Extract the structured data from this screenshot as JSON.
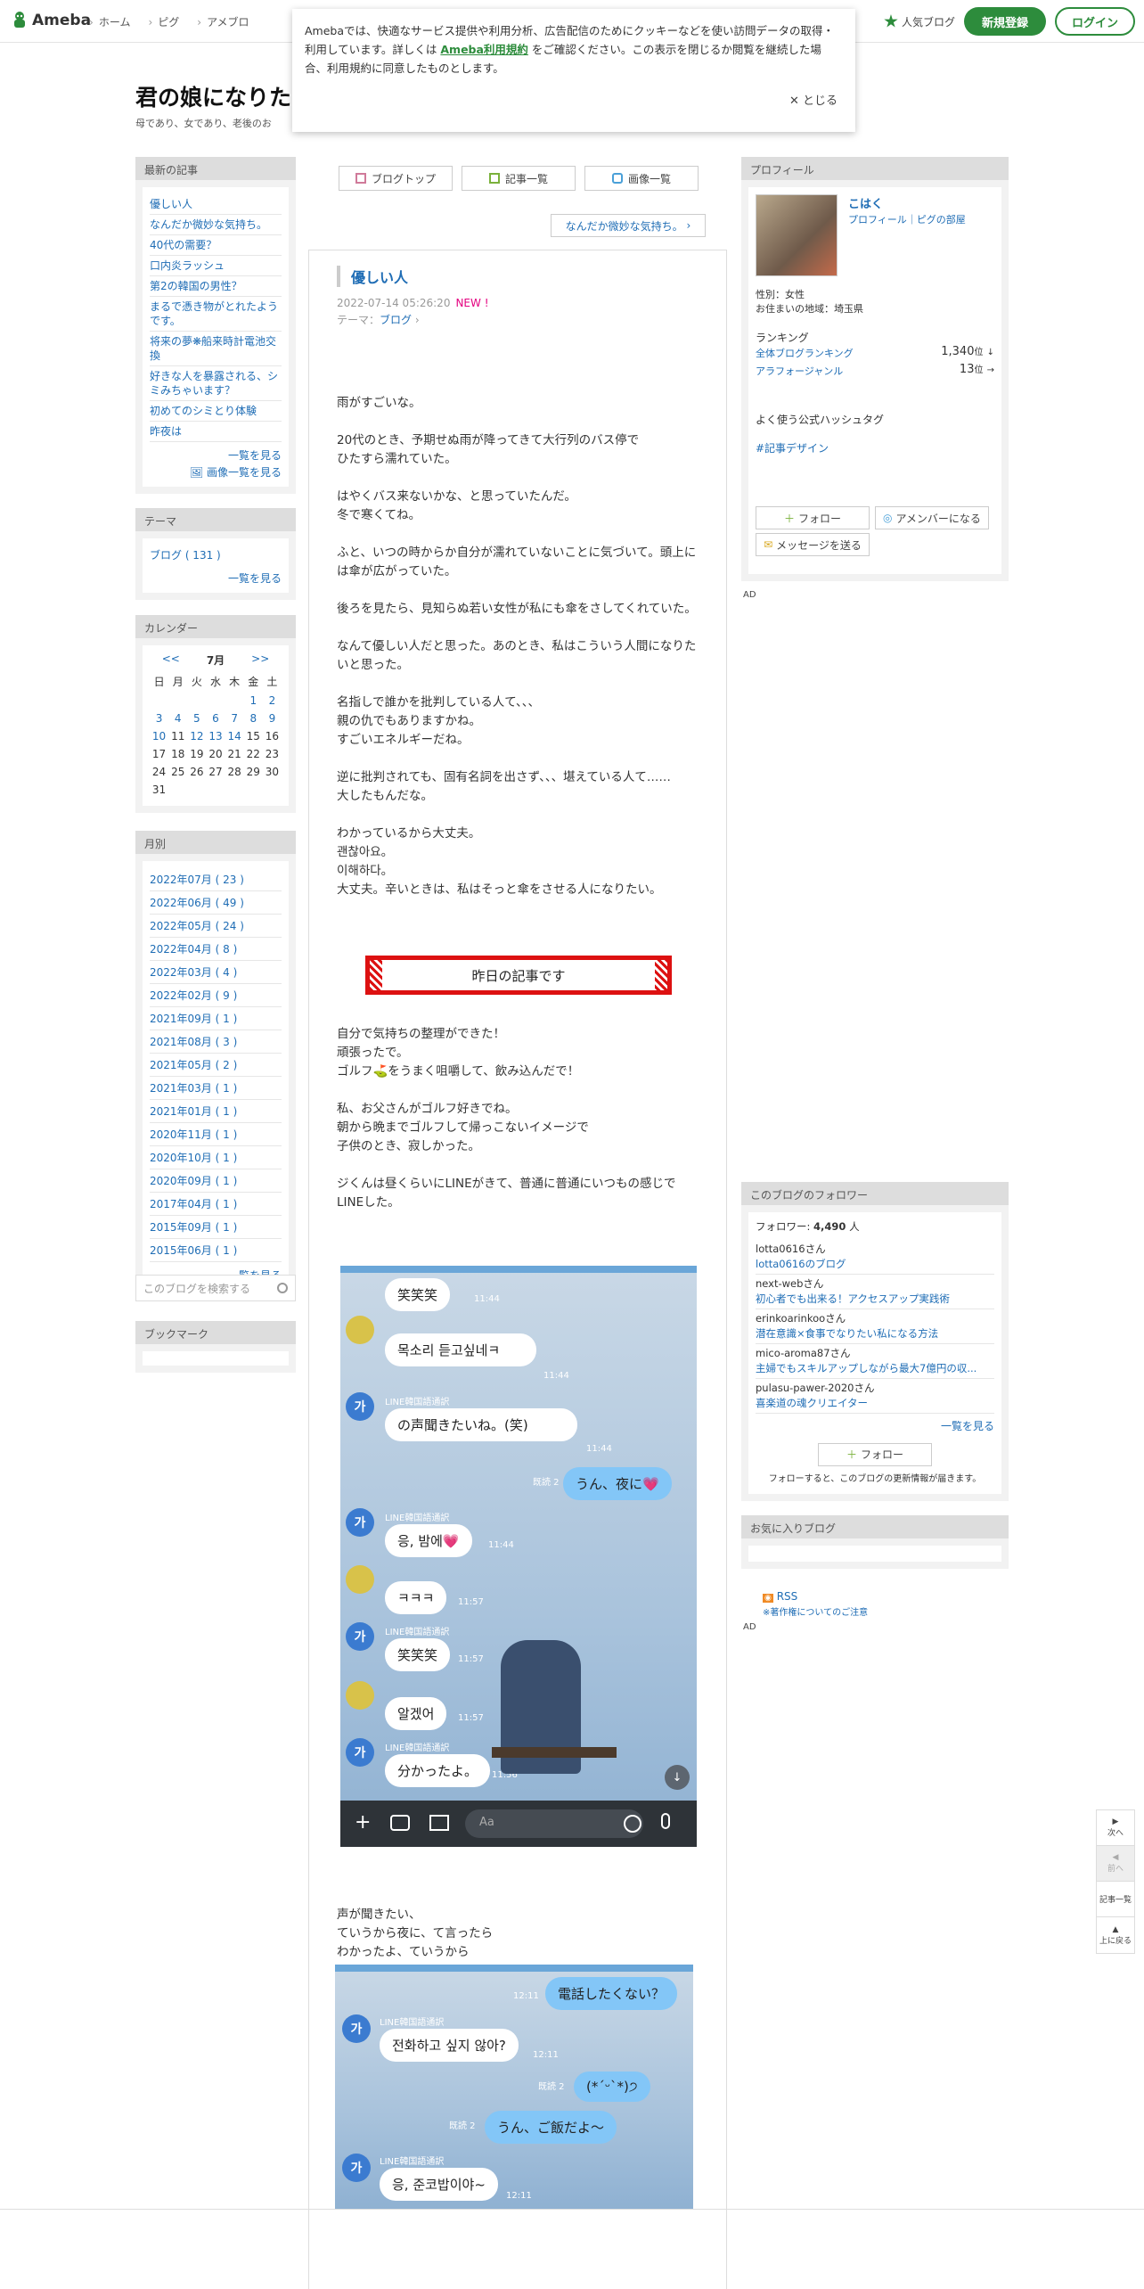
{
  "header": {
    "logo": "Ameba",
    "nav": [
      "ホーム",
      "ピグ",
      "アメブロ"
    ],
    "popular": "人気ブログ",
    "register": "新規登録",
    "login": "ログイン"
  },
  "cookie": {
    "text1": "Amebaでは、快適なサービス提供や利用分析、広告配信のためにクッキーなどを使い訪問データの取得・利用しています。詳しくは",
    "link": "Ameba利用規約",
    "text2": "をご確認ください。この表示を閉じるか閲覧を継続した場合、利用規約に同意したものとします。",
    "close": "✕ とじる"
  },
  "blog": {
    "title": "君の娘になりた",
    "desc": "母であり、女であり、老後のお"
  },
  "latest": {
    "heading": "最新の記事",
    "items": [
      "優しい人",
      "なんだか微妙な気持ち。",
      "40代の需要？",
      "口内炎ラッシュ",
      "第2の韓国の男性？",
      "まるで憑き物がとれたようです。",
      "将来の夢❋船来時計電池交換",
      "好きな人を暴露される、シミみちゃいます？",
      "初めてのシミとり体験",
      "昨夜は"
    ],
    "more": "一覧を見る",
    "img_more": "画像一覧を見る"
  },
  "theme": {
    "heading": "テーマ",
    "item": "ブログ ( 131 )",
    "more": "一覧を見る"
  },
  "calendar": {
    "heading": "カレンダー",
    "prev": "<<",
    "month": "7月",
    "next": ">>",
    "days": [
      "日",
      "月",
      "火",
      "水",
      "木",
      "金",
      "土"
    ],
    "rows": [
      [
        "",
        "",
        "",
        "",
        "",
        "1",
        "2"
      ],
      [
        "3",
        "4",
        "5",
        "6",
        "7",
        "8",
        "9"
      ],
      [
        "10",
        "11",
        "12",
        "13",
        "14",
        "15",
        "16"
      ],
      [
        "17",
        "18",
        "19",
        "20",
        "21",
        "22",
        "23"
      ],
      [
        "24",
        "25",
        "26",
        "27",
        "28",
        "29",
        "30"
      ],
      [
        "31",
        "",
        "",
        "",
        "",
        "",
        ""
      ]
    ]
  },
  "monthly": {
    "heading": "月別",
    "items": [
      "2022年07月 ( 23 )",
      "2022年06月 ( 49 )",
      "2022年05月 ( 24 )",
      "2022年04月 ( 8 )",
      "2022年03月 ( 4 )",
      "2022年02月 ( 9 )",
      "2021年09月 ( 1 )",
      "2021年08月 ( 3 )",
      "2021年05月 ( 2 )",
      "2021年03月 ( 1 )",
      "2021年01月 ( 1 )",
      "2020年11月 ( 1 )",
      "2020年10月 ( 1 )",
      "2020年09月 ( 1 )",
      "2017年04月 ( 1 )",
      "2015年09月 ( 1 )",
      "2015年06月 ( 1 )"
    ],
    "more": "一覧を見る"
  },
  "search": {
    "placeholder": "このブログを検索する"
  },
  "bookmark": {
    "heading": "ブックマーク"
  },
  "tabs": [
    "ブログトップ",
    "記事一覧",
    "画像一覧"
  ],
  "prev_article": "なんだか微妙な気持ち。",
  "entry": {
    "title": "優しい人",
    "date": "2022-07-14 05:26:20",
    "new": "NEW !",
    "theme_label": "テーマ：",
    "theme": "ブログ",
    "p1": [
      "雨がすごいな。",
      "",
      "20代のとき、予期せぬ雨が降ってきて大行列のバス停で",
      "ひたすら濡れていた。",
      "",
      "はやくバス来ないかな、と思っていたんだ。",
      "冬で寒くてね。",
      "",
      "ふと、いつの時からか自分が濡れていないことに気づいて。頭上には傘が広がっていた。",
      "",
      "後ろを見たら、見知らぬ若い女性が私にも傘をさしてくれていた。",
      "",
      "なんて優しい人だと思った。あのとき、私はこういう人間になりたいと思った。",
      "",
      "名指しで誰かを批判している人て、、、",
      "親の仇でもありますかね。",
      "すごいエネルギーだね。",
      "",
      "逆に批判されても、固有名詞を出さず、、、堪えている人て……",
      "大したもんだな。",
      "",
      "わかっているから大丈夫。",
      "괜찮아요。",
      "이해하다。",
      "大丈夫。辛いときは、私はそっと傘をさせる人になりたい。"
    ],
    "banner": "昨日の記事です",
    "p2": [
      "自分で気持ちの整理ができた！",
      "頑張ったで。",
      "ゴルフ⛳をうまく咀嚼して、飲み込んだで！",
      "",
      "私、お父さんがゴルフ好きでね。",
      "朝から晩までゴルフして帰っこないイメージで",
      "子供のとき、寂しかった。",
      "",
      "ジくんは昼くらいにLINEがきて、普通に普通にいつもの感じでLINEした。"
    ],
    "p3": [
      "声が聞きたい、",
      "ていうから夜に、て言ったら",
      "わかったよ、ていうから"
    ]
  },
  "chat1": {
    "b1": "笑笑笑",
    "b2": "목소리 듣고싶네ㅋ",
    "trans": "LINE韓国語通訳",
    "b3": "の声聞きたいね。(笑)",
    "b4": "うん、夜に💗",
    "read": "既読 2",
    "b5": "응, 밤에💗",
    "b6": "ㅋㅋㅋ",
    "b7": "笑笑笑",
    "b8": "알겠어",
    "b9": "分かったよ。",
    "t1": "11:44",
    "t2": "11:57",
    "t3": "11:56",
    "av": "가",
    "input": "Aa"
  },
  "chat2": {
    "b1": "電話したくない？",
    "b2": "전화하고 싶지 않아?",
    "b3": "(*ˊᵕˋ*)੭",
    "b4": "うん、ご飯だよ〜",
    "b5": "응, 준코밥이야~",
    "t": "12:11",
    "read": "既読 2",
    "trans": "LINE韓国語通訳",
    "av": "가"
  },
  "profile": {
    "heading": "プロフィール",
    "name": "こはく",
    "links": "プロフィール｜ピグの部屋",
    "gender": "性別：女性",
    "area": "お住まいの地域：埼玉県",
    "ranking": "ランキング",
    "rank1_label": "全体ブログランキング",
    "rank1": "1,340",
    "rank2_label": "アラフォージャンル",
    "rank2": "13",
    "rank_unit": "位",
    "hashtag_heading": "よく使う公式ハッシュタグ",
    "hashtag": "#記事デザイン",
    "follow": "フォロー",
    "member": "アメンバーになる",
    "message": "メッセージを送る"
  },
  "ad": "AD",
  "followers": {
    "heading": "このブログのフォロワー",
    "count_label": "フォロワー:",
    "count": "4,490",
    "unit": "人",
    "items": [
      {
        "user": "lotta0616さん",
        "blog": "lotta0616のブログ"
      },
      {
        "user": "next-webさん",
        "blog": "初心者でも出来る！アクセスアップ実践術"
      },
      {
        "user": "erinkoarinkooさん",
        "blog": "潜在意識×食事でなりたい私になる方法"
      },
      {
        "user": "mico-aroma87さん",
        "blog": "主婦でもスキルアップしながら最大7億円の収..."
      },
      {
        "user": "pulasu-pawer-2020さん",
        "blog": "喜楽道の魂クリエイター"
      }
    ],
    "more": "一覧を見る",
    "follow": "フォロー",
    "note": "フォローすると、このブログの更新情報が届きます。"
  },
  "favorites": {
    "heading": "お気に入りブログ"
  },
  "rss": "RSS",
  "copyright": "※著作権についてのご注意",
  "float": {
    "next": "次へ",
    "prev": "前へ",
    "list": "記事一覧",
    "top": "上に戻る"
  }
}
